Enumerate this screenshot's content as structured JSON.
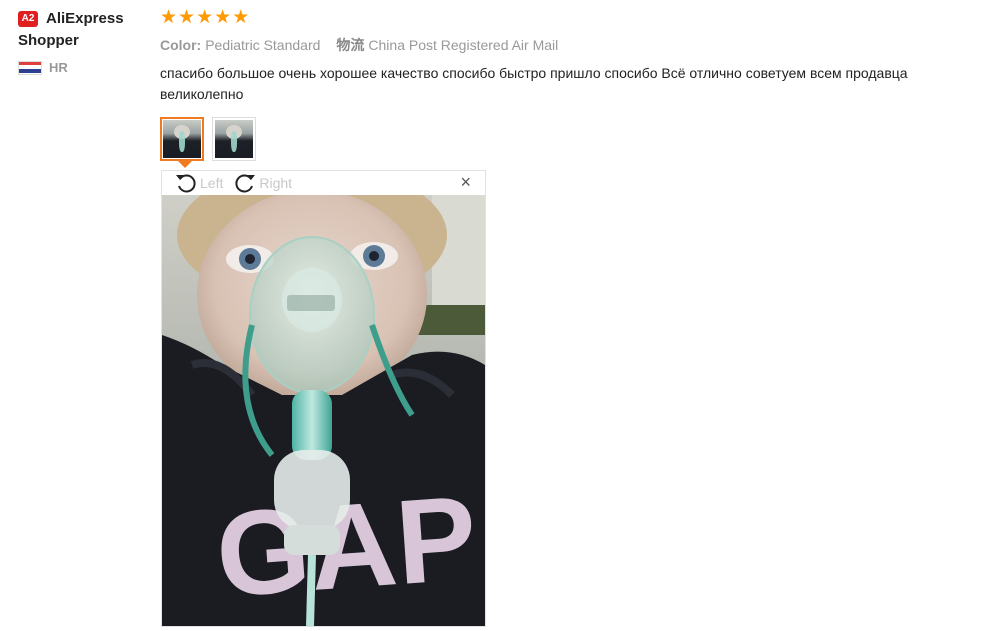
{
  "buyer": {
    "badge": "A2",
    "name_line1": "AliExpress",
    "name_line2": "Shopper",
    "country_code": "HR",
    "flag_icon": "croatia-flag-icon"
  },
  "review": {
    "rating": 5,
    "stars": [
      "★",
      "★",
      "★",
      "★",
      "★"
    ],
    "color_label": "Color:",
    "color_value": "Pediatric Standard",
    "logistics_label": "物流",
    "logistics_value": "China Post Registered Air Mail",
    "text": "спасибо большое очень хорошее качество спосибо быстро пришло спосибо Всё отлично советуем всем продавца великолепно",
    "thumbnails": [
      {
        "name": "photo-1",
        "active": true
      },
      {
        "name": "photo-2",
        "active": false
      }
    ]
  },
  "viewer": {
    "rotate_left_label": "Left",
    "rotate_right_label": "Right",
    "close_label": "×"
  },
  "colors": {
    "star": "#ff9a00",
    "active_thumb_border": "#f07a1f",
    "badge_bg": "#e02020",
    "muted_text": "#999999"
  }
}
